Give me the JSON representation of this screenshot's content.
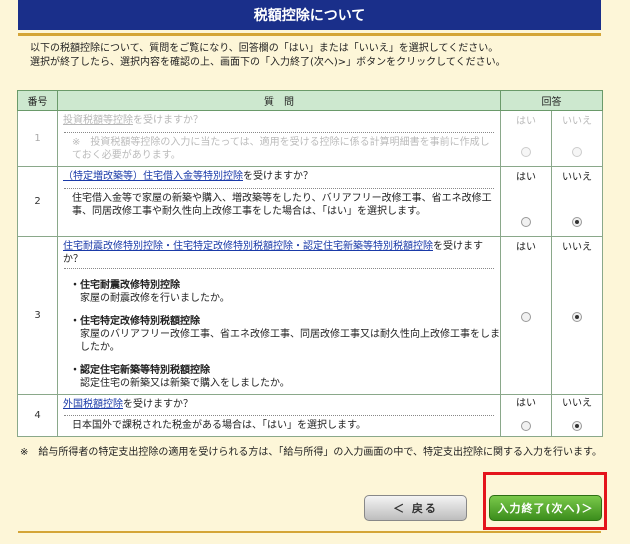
{
  "header": {
    "title": "税額控除について"
  },
  "instructions": {
    "line1": "以下の税額控除について、質問をご覧になり、回答欄の「はい」または「いいえ」を選択してください。",
    "line2": "選択が終了したら、選択内容を確認の上、画面下の「入力終了(次へ)>」ボタンをクリックしてください。"
  },
  "table": {
    "headers": {
      "number": "番号",
      "question": "質　問",
      "answer": "回答"
    },
    "rows": [
      {
        "number": "1",
        "link": "投資税額等控除",
        "question_suffix": "を受けますか？",
        "note": "※　投資税額等控除の入力に当たっては、適用を受ける控除に係る計算明細書を事前に作成しておく必要があります。",
        "yes": "はい",
        "no": "いいえ",
        "selected": "none",
        "disabled": true
      },
      {
        "number": "2",
        "link": "（特定増改築等）住宅借入金等特別控除",
        "question_suffix": "を受けますか？",
        "note": "住宅借入金等で家屋の新築や購入、増改築等をしたり、バリアフリー改修工事、省エネ改修工事、同居改修工事や耐久性向上改修工事をした場合は、「はい」を選択します。",
        "yes": "はい",
        "no": "いいえ",
        "selected": "no",
        "disabled": false
      },
      {
        "number": "3",
        "link": "住宅耐震改修特別控除・住宅特定改修特別税額控除・認定住宅新築等特別税額控除",
        "question_suffix": "を受けますか？",
        "items": [
          {
            "title": "・住宅耐震改修特別控除",
            "desc": "家屋の耐震改修を行いましたか。"
          },
          {
            "title": "・住宅特定改修特別税額控除",
            "desc": "家屋のバリアフリー改修工事、省エネ改修工事、同居改修工事又は耐久性向上改修工事をしましたか。"
          },
          {
            "title": "・認定住宅新築等特別税額控除",
            "desc": "認定住宅の新築又は新築で購入をしましたか。"
          }
        ],
        "yes": "はい",
        "no": "いいえ",
        "selected": "no",
        "disabled": false
      },
      {
        "number": "4",
        "link": "外国税額控除",
        "question_suffix": "を受けますか？",
        "note": "日本国外で課税された税金がある場合は、「はい」を選択します。",
        "yes": "はい",
        "no": "いいえ",
        "selected": "no",
        "disabled": false
      }
    ]
  },
  "footnote": "※　給与所得者の特定支出控除の適用を受けられる方は、「給与所得」の入力画面の中で、特定支出控除に関する入力を行います。",
  "buttons": {
    "back": "＜ 戻る",
    "next": "入力終了(次へ)＞"
  },
  "colors": {
    "header_bg": "#1a2f8a",
    "highlight": "#e4141c",
    "next_button": "#4a9e24"
  }
}
